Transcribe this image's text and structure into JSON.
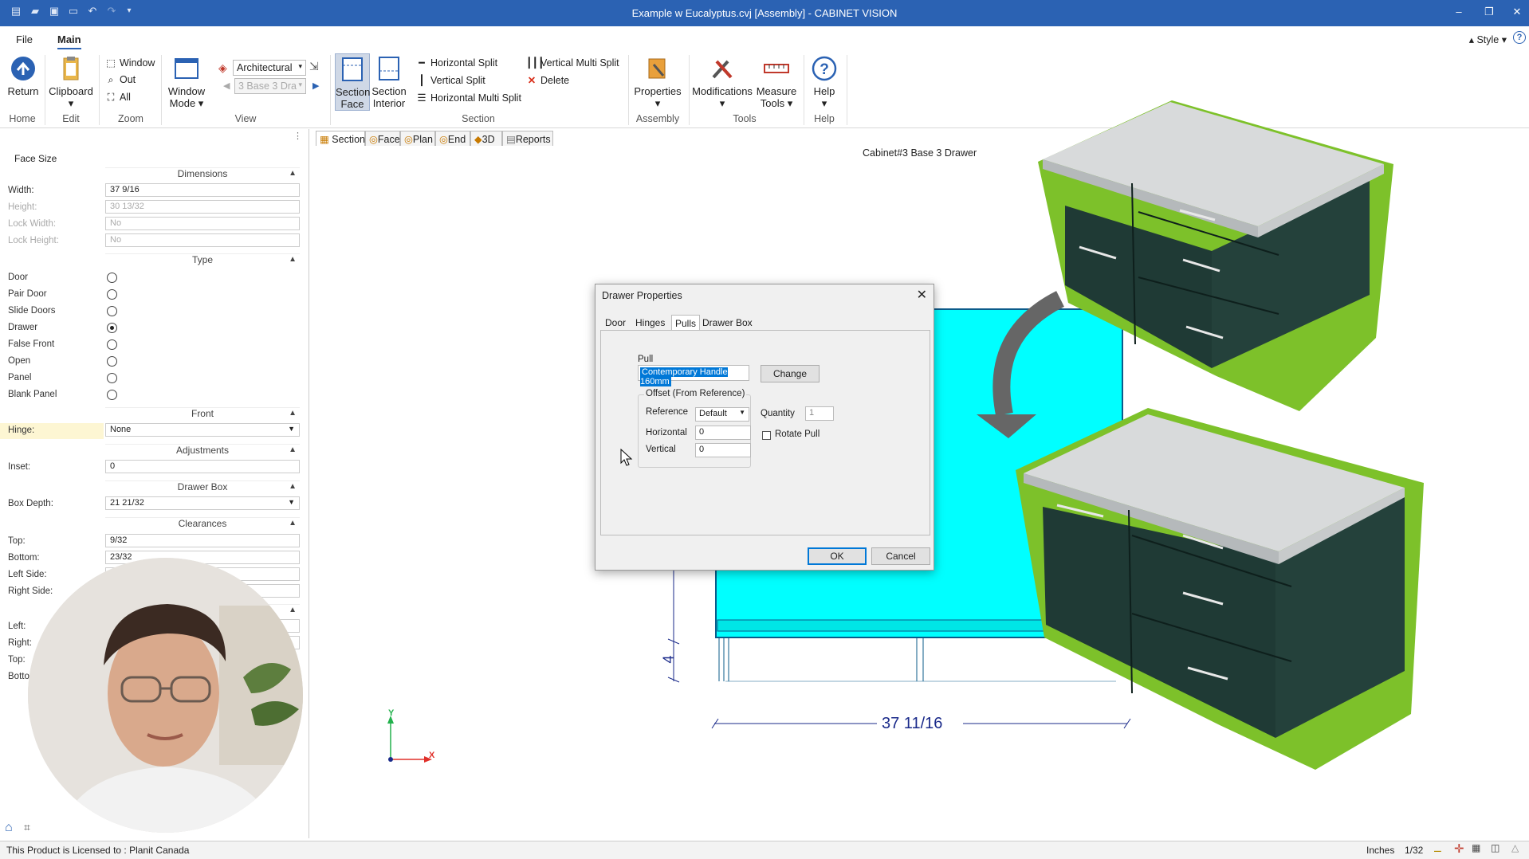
{
  "window": {
    "title": "Example w Eucalyptus.cvj [Assembly] - CABINET VISION"
  },
  "menu": {
    "file": "File",
    "main": "Main",
    "style": "Style"
  },
  "ribbon": {
    "return": "Return",
    "clipboard": "Clipboard",
    "zoom_window": "Window",
    "zoom_out": "Out",
    "zoom_all": "All",
    "window_mode": "Window Mode",
    "view_combo": "Architectural",
    "cabinet_combo": "3 Base 3 Dra",
    "section_face": "Section Face",
    "section_interior": "Section Interior",
    "horizontal_split": "Horizontal Split",
    "vertical_split": "Vertical Split",
    "horizontal_multi_split": "Horizontal Multi Split",
    "vertical_multi_split": "Vertical Multi Split",
    "delete": "Delete",
    "properties": "Properties",
    "modifications": "Modifications",
    "measure_tools": "Measure Tools",
    "help": "Help",
    "groups": {
      "home": "Home",
      "edit": "Edit",
      "zoom": "Zoom",
      "view": "View",
      "section": "Section",
      "assembly": "Assembly",
      "tools": "Tools",
      "help": "Help"
    }
  },
  "panel": {
    "title": "Face Size",
    "dimensions": "Dimensions",
    "width_label": "Width:",
    "width": "37 9/16",
    "height_label": "Height:",
    "height": "30 13/32",
    "lock_width_label": "Lock Width:",
    "lock_width": "No",
    "lock_height_label": "Lock Height:",
    "lock_height": "No",
    "type": "Type",
    "types": [
      "Door",
      "Pair Door",
      "Slide Doors",
      "Drawer",
      "False Front",
      "Open",
      "Panel",
      "Blank Panel"
    ],
    "front": "Front",
    "hinge_label": "Hinge:",
    "hinge": "None",
    "adjustments": "Adjustments",
    "inset_label": "Inset:",
    "inset": "0",
    "drawer_box": "Drawer Box",
    "box_depth_label": "Box Depth:",
    "box_depth": "21 21/32",
    "clearances": "Clearances",
    "top_label": "Top:",
    "top": "9/32",
    "bottom_label": "Bottom:",
    "bottom": "23/32",
    "left_side_label": "Left Side:",
    "right_side_label": "Right Side:",
    "left_label": "Left:",
    "right_label": "Right:",
    "top2_label": "Top:",
    "bottom2_label": "Botto"
  },
  "view_tabs": [
    "Section",
    "Face",
    "Plan",
    "End",
    "3D",
    "Reports"
  ],
  "canvas": {
    "cabinet_label": "Cabinet#3 Base 3 Drawer",
    "dim_width": "37 11/16",
    "dim_height": "4",
    "axis_y": "Y",
    "axis_x": "X"
  },
  "dialog": {
    "title": "Drawer Properties",
    "tabs": [
      "Door",
      "Hinges",
      "Pulls",
      "Drawer Box"
    ],
    "pull_label": "Pull",
    "pull_value": "Contemporary Handle 160mm",
    "change": "Change",
    "offset_group": "Offset (From Reference)",
    "reference_label": "Reference",
    "reference": "Default",
    "horizontal_label": "Horizontal",
    "horizontal": "0",
    "vertical_label": "Vertical",
    "vertical": "0",
    "quantity_label": "Quantity",
    "quantity": "1",
    "rotate_pull": "Rotate Pull",
    "ok": "OK",
    "cancel": "Cancel"
  },
  "status": {
    "license": "This Product is Licensed to : Planit Canada",
    "units": "Inches",
    "precision": "1/32"
  },
  "colors": {
    "titlebar": "#2b62b3",
    "cabinet_fill": "#00ffff",
    "cabinet_body": "#1f3a35",
    "highlight": "#7dc12a",
    "accent": "#0078d7"
  }
}
